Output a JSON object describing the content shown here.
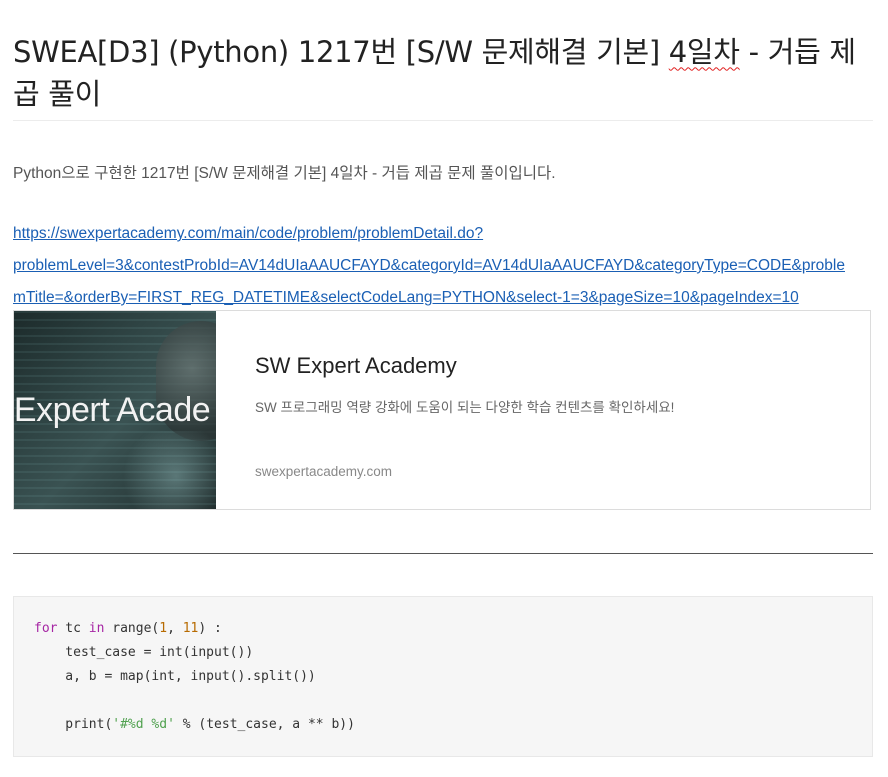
{
  "post": {
    "title_main": "SWEA[D3] (Python) 1217번 [S/W 문제해결 기본] ",
    "title_spell": "4일차",
    "title_rest": " - 거듭 제곱 풀이",
    "intro": "Python으로 구현한 1217번 [S/W 문제해결 기본] 4일차 - 거듭 제곱 문제 풀이입니다.",
    "link_line1": "https://swexpertacademy.com/main/code/problem/problemDetail.do?",
    "link_line2": "problemLevel=3&contestProbId=AV14dUIaAAUCFAYD&categoryId=AV14dUIaAAUCFAYD&categoryType=CODE&proble",
    "link_line3": "mTitle=&orderBy=FIRST_REG_DATETIME&selectCodeLang=PYTHON&select-1=3&pageSize=10&pageIndex=10"
  },
  "card": {
    "thumb_text": "/ Expert Acade",
    "title": "SW Expert Academy",
    "description": "SW 프로그래밍 역량 강화에 도움이 되는 다양한 학습 컨텐츠를 확인하세요!",
    "domain": "swexpertacademy.com"
  },
  "code": {
    "line1_kw_for": "for",
    "line1_a": " tc ",
    "line1_kw_in": "in",
    "line1_b": " range(",
    "line1_n1": "1",
    "line1_c": ", ",
    "line1_n2": "11",
    "line1_d": ") :",
    "line2": "    test_case = int(input())",
    "line3": "    a, b = map(int, input().split())",
    "line4": "",
    "line5_a": "    print(",
    "line5_str": "'#%d %d'",
    "line5_b": " % (test_case, a ** b))"
  },
  "colors": {
    "link": "#1a5fb4",
    "keyword": "#a626a4",
    "number": "#b76b01",
    "string": "#50a14f"
  }
}
